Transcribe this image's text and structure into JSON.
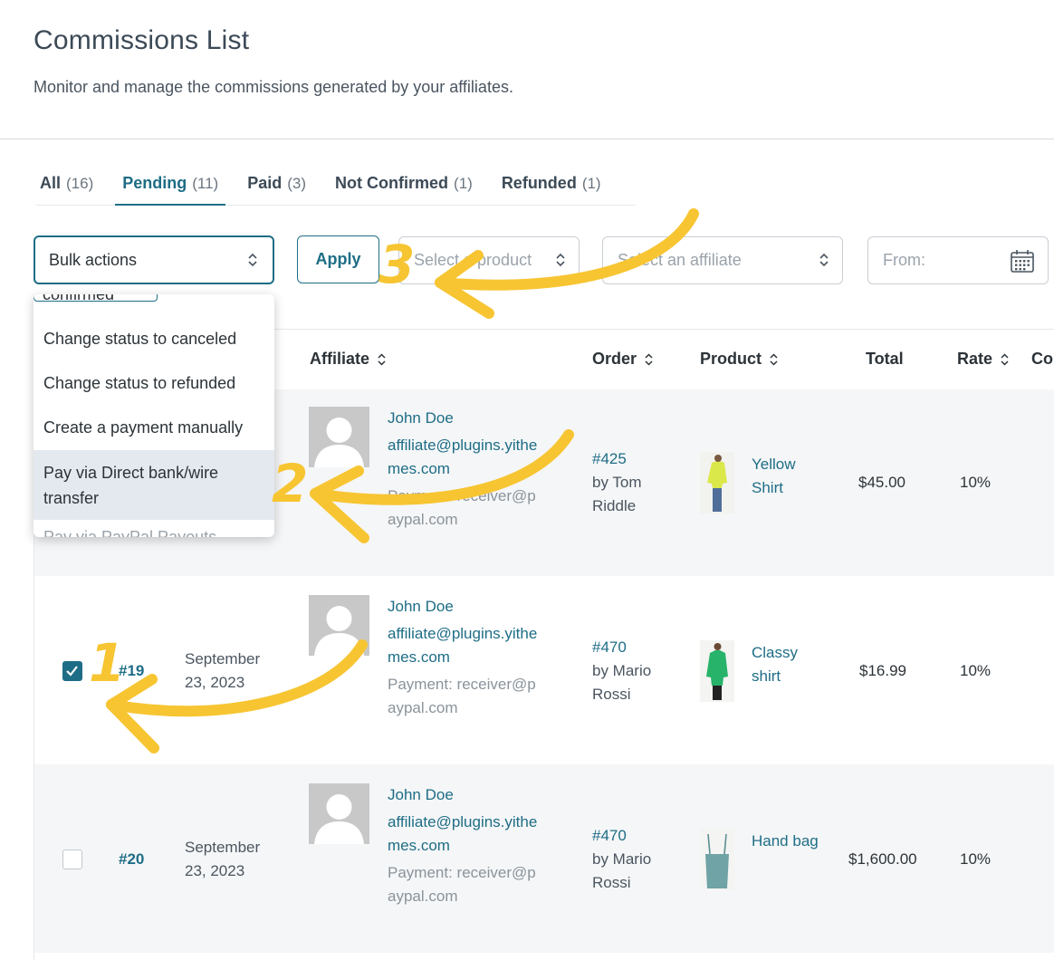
{
  "page": {
    "title": "Commissions List",
    "subtitle": "Monitor and manage the commissions generated by your affiliates."
  },
  "tabs": [
    {
      "label": "All",
      "count": "(16)"
    },
    {
      "label": "Pending",
      "count": "(11)"
    },
    {
      "label": "Paid",
      "count": "(3)"
    },
    {
      "label": "Not Confirmed",
      "count": "(1)"
    },
    {
      "label": "Refunded",
      "count": "(1)"
    }
  ],
  "toolbar": {
    "bulk_actions": "Bulk actions",
    "apply": "Apply",
    "product_placeholder": "Select a product",
    "affiliate_placeholder": "Select an affiliate",
    "from_placeholder": "From:"
  },
  "bulk_menu": {
    "partial_top": "confirmed",
    "items": [
      "Change status to canceled",
      "Change status to refunded",
      "Create a payment manually",
      "Pay via Direct bank/wire transfer"
    ],
    "partial_bottom": "Pay via PayPal Payouts"
  },
  "table": {
    "headers": {
      "affiliate": "Affiliate",
      "order": "Order",
      "product": "Product",
      "total": "Total",
      "rate": "Rate",
      "commission": "Co"
    },
    "rows": [
      {
        "id": "",
        "date": "",
        "affiliate_name": "John Doe",
        "affiliate_email": "affiliate@plugins.yithemes.com",
        "payment": "Payment: receiver@paypal.com",
        "order": "#425",
        "order_by": "by Tom Riddle",
        "product": "Yellow Shirt",
        "total": "$45.00",
        "rate": "10%"
      },
      {
        "id": "#19",
        "date": "September 23, 2023",
        "affiliate_name": "John Doe",
        "affiliate_email": "affiliate@plugins.yithemes.com",
        "payment": "Payment: receiver@paypal.com",
        "order": "#470",
        "order_by": "by Mario Rossi",
        "product": "Classy shirt",
        "total": "$16.99",
        "rate": "10%"
      },
      {
        "id": "#20",
        "date": "September 23, 2023",
        "affiliate_name": "John Doe",
        "affiliate_email": "affiliate@plugins.yithemes.com",
        "payment": "Payment: receiver@paypal.com",
        "order": "#470",
        "order_by": "by Mario Rossi",
        "product": "Hand bag",
        "total": "$1,600.00",
        "rate": "10%"
      }
    ]
  },
  "annotations": {
    "step1": "1",
    "step2": "2",
    "step3": "3"
  },
  "colors": {
    "accent": "#1e6d86",
    "annotation": "#f7c532"
  }
}
